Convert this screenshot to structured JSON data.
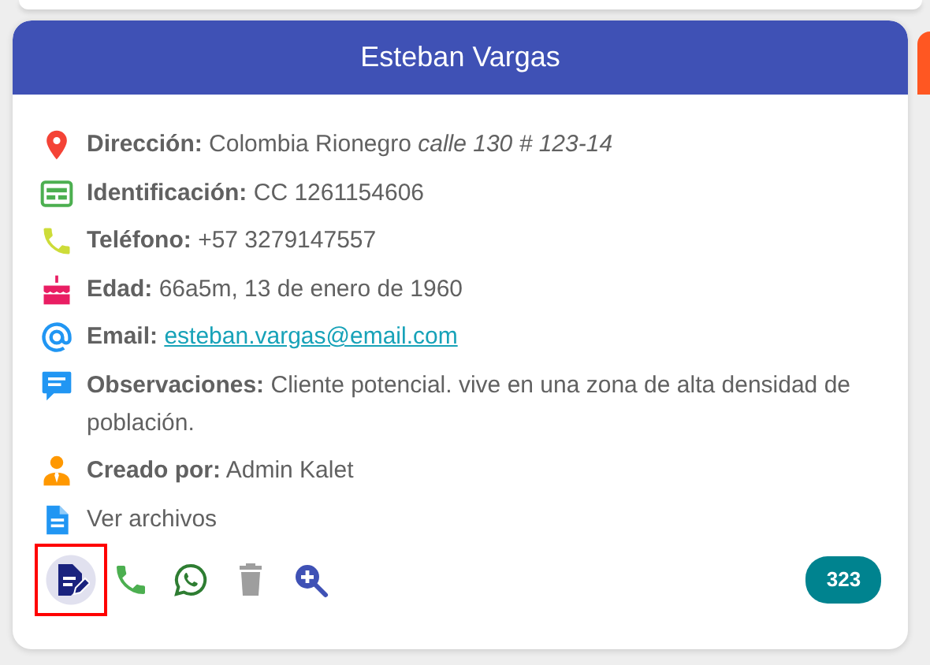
{
  "card": {
    "title": "Esteban Vargas",
    "fields": [
      {
        "kind": "address",
        "label": "Dirección:",
        "value": "Colombia Rionegro *calle 130 # 123-14*"
      },
      {
        "kind": "id",
        "label": "Identificación:",
        "value": "CC 1261154606"
      },
      {
        "kind": "phone",
        "label": "Teléfono:",
        "value": "+57 3279147557"
      },
      {
        "kind": "age",
        "label": "Edad:",
        "value": "66a5m, 13 de enero de 1960"
      },
      {
        "kind": "email",
        "label": "Email:",
        "value": "esteban.vargas@email.com"
      },
      {
        "kind": "notes",
        "label": "Observaciones:",
        "value": "Cliente potencial. vive en una zona de alta densidad de población."
      },
      {
        "kind": "creator",
        "label": "Creado por:",
        "value": "Admin Kalet"
      },
      {
        "kind": "files",
        "value": "Ver archivos"
      }
    ],
    "actions": [
      {
        "kind": "edit",
        "selected": true
      },
      {
        "kind": "call",
        "selected": false
      },
      {
        "kind": "whatsapp",
        "selected": false
      },
      {
        "kind": "delete",
        "selected": false
      },
      {
        "kind": "zoom",
        "selected": false
      }
    ],
    "badge": "323"
  }
}
